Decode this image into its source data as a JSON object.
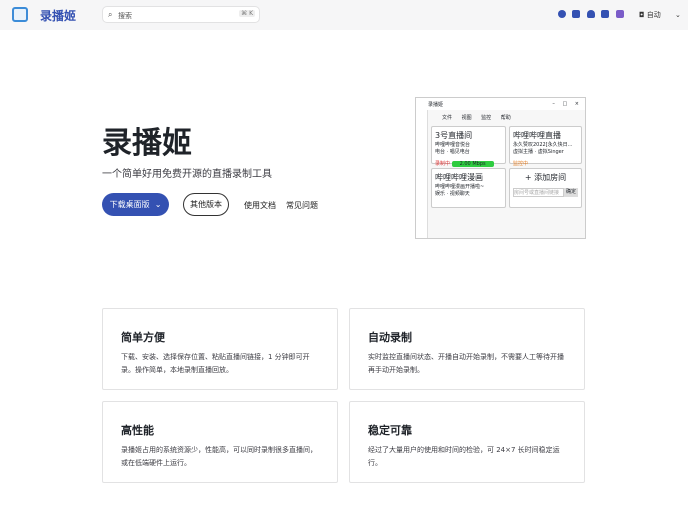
{
  "nav": {
    "brand": "录播姬",
    "search_placeholder": "搜索",
    "search_shortcut": "⌘ K",
    "theme": "自动"
  },
  "hero": {
    "title": "录播姬",
    "subtitle": "一个简单好用免费开源的直播录制工具",
    "download": "下载桌面版",
    "other": "其他版本",
    "docs": "使用文档",
    "faq": "常见问题"
  },
  "app": {
    "title": "录播姬",
    "menu": "文件 视图 监控 帮助",
    "rooms": [
      {
        "name": "3号直播间",
        "line1": "哔哩哔哩音悦台",
        "line2": "电台 · 唱见电台",
        "status": "录制中",
        "speed": "2.00 Mbps"
      },
      {
        "name": "哔哩哔哩直播",
        "line1": "永久赞叹2022[永久快日...",
        "line2": "虚拟主播 · 虚拟Singer",
        "status": "监控中"
      },
      {
        "name": "哔哩哔哩漫画",
        "line1": "哔哩哔哩漫画开播啦~",
        "line2": "娱乐 · 视频聊天"
      }
    ],
    "add": "+ 添加房间",
    "add_placeholder": "房间号或直播间链接",
    "confirm": "确定"
  },
  "features": [
    {
      "title": "简单方便",
      "text": "下载、安装、选择保存位置、粘贴直播间链接，1 分钟即可开录。操作简单，本地录制直播回放。"
    },
    {
      "title": "自动录制",
      "text": "实时监控直播间状态、开播自动开始录制，不需要人工等待开播再手动开始录制。"
    },
    {
      "title": "高性能",
      "text": "录播姬占用的系统资源少，性能高，可以同时录制很多直播间，或在低端硬件上运行。"
    },
    {
      "title": "稳定可靠",
      "text": "经过了大量用户的使用和时间的检验，可 24×7 长时间稳定运行。"
    }
  ]
}
